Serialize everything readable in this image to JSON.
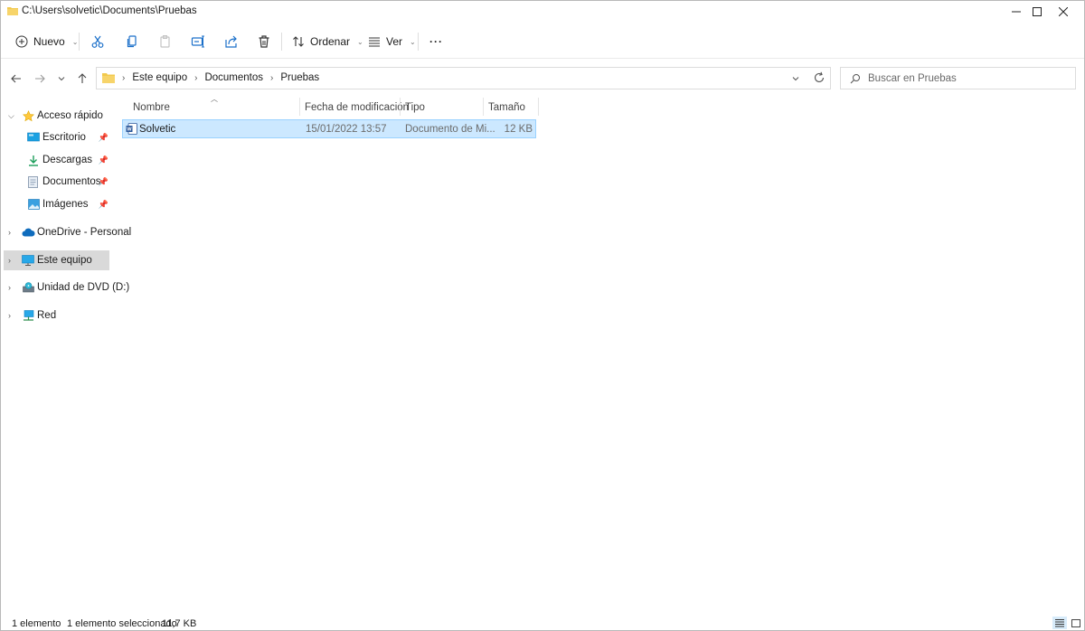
{
  "window": {
    "title": "C:\\Users\\solvetic\\Documents\\Pruebas"
  },
  "toolbar": {
    "new_label": "Nuevo",
    "sort_label": "Ordenar",
    "view_label": "Ver",
    "more_label": "···"
  },
  "address": {
    "crumbs": [
      "Este equipo",
      "Documentos",
      "Pruebas"
    ]
  },
  "search": {
    "placeholder": "Buscar en Pruebas"
  },
  "nav": {
    "items": [
      {
        "label": "Acceso rápido",
        "icon": "star-icon"
      },
      {
        "label": "Escritorio",
        "icon": "desktop-icon",
        "pinned": true
      },
      {
        "label": "Descargas",
        "icon": "download-icon",
        "pinned": true
      },
      {
        "label": "Documentos",
        "icon": "document-icon",
        "pinned": true
      },
      {
        "label": "Imágenes",
        "icon": "pictures-icon",
        "pinned": true
      },
      {
        "label": "OneDrive - Personal",
        "icon": "cloud-icon"
      },
      {
        "label": "Este equipo",
        "icon": "computer-icon",
        "selected": true
      },
      {
        "label": "Unidad de DVD (D:)",
        "icon": "dvd-icon"
      },
      {
        "label": "Red",
        "icon": "network-icon"
      }
    ]
  },
  "columns": [
    "Nombre",
    "Fecha de modificación",
    "Tipo",
    "Tamaño"
  ],
  "files": [
    {
      "name": "Solvetic",
      "modified": "15/01/2022 13:57",
      "type": "Documento de Mi...",
      "size": "12 KB",
      "selected": true
    }
  ],
  "status": {
    "count": "1 elemento",
    "selection": "1 elemento seleccionado",
    "size": "11,7 KB"
  },
  "colors": {
    "accent": "#0078d4",
    "selection_bg": "#cce8ff",
    "selection_border": "#99d1ff",
    "folder": "#f2c94c"
  }
}
